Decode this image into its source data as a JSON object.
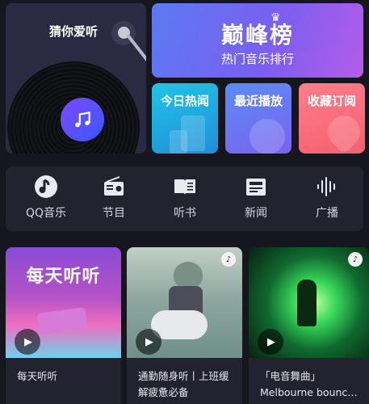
{
  "vinyl_card": {
    "title": "猜你爱听"
  },
  "chart_banner": {
    "title": "巅峰榜",
    "subtitle": "热门音乐排行"
  },
  "quick_cards": [
    {
      "label": "今日热闻",
      "color": "#22c4e6"
    },
    {
      "label": "最近播放",
      "color": "#6a78f2"
    },
    {
      "label": "收藏订阅",
      "color": "#f46c7a"
    }
  ],
  "categories": [
    {
      "label": "QQ音乐",
      "icon": "qq-music-icon"
    },
    {
      "label": "节目",
      "icon": "radio-icon"
    },
    {
      "label": "听书",
      "icon": "book-icon"
    },
    {
      "label": "新闻",
      "icon": "news-icon"
    },
    {
      "label": "广播",
      "icon": "broadcast-icon"
    }
  ],
  "playlists": [
    {
      "cover_text": "每天听听",
      "lines": [
        "每天听听"
      ]
    },
    {
      "cover_text": "",
      "lines": [
        "通勤随身听丨上班缓",
        "解疲惫必备"
      ]
    },
    {
      "cover_text": "",
      "lines": [
        "「电音舞曲」",
        "Melbourne bounce..."
      ]
    }
  ]
}
